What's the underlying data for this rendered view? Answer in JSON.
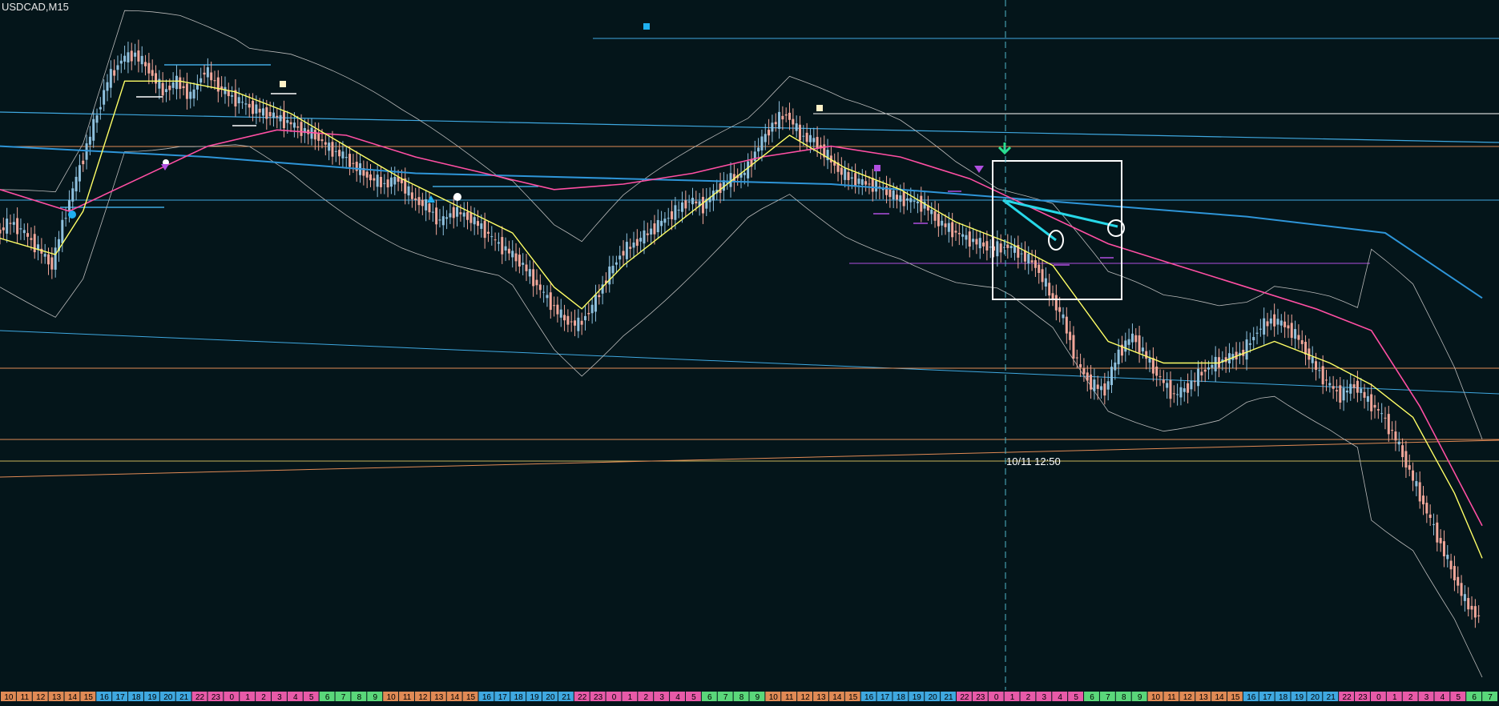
{
  "window": {
    "symbol_title": "USDCAD,M15"
  },
  "colors": {
    "background": "#04151a",
    "candle_up": "#8fc1df",
    "candle_down": "#f2a79a",
    "ema_fast": "#ffff66",
    "ema_slow": "#ff4fa3",
    "ma_long": "#2e95d8",
    "bollinger": "#b9b9b9",
    "support_resistance_cyan": "#3fa8e0",
    "support_resistance_orange": "#e08a55",
    "marker_white": "#ffffff",
    "marker_purple": "#b04fe0",
    "marker_green": "#27e08c",
    "marker_cream": "#fff2c8"
  },
  "chart_data": {
    "type": "candlestick",
    "symbol": "USDCAD",
    "timeframe": "M15",
    "cursor_label": "10/11 12:50",
    "hour_labels": [
      "10",
      "11",
      "12",
      "13",
      "14",
      "15",
      "16",
      "17",
      "18",
      "19",
      "20",
      "21",
      "22",
      "23",
      "0",
      "1",
      "2",
      "3",
      "4",
      "5",
      "6",
      "7",
      "8",
      "9",
      "10",
      "11",
      "12",
      "13",
      "14",
      "15",
      "16",
      "17",
      "18",
      "19",
      "20",
      "21",
      "22",
      "23",
      "0",
      "1",
      "2",
      "3",
      "4",
      "5",
      "6",
      "7",
      "8",
      "9",
      "10",
      "11",
      "12",
      "13",
      "14",
      "15",
      "16",
      "17",
      "18",
      "19",
      "20",
      "21",
      "22",
      "23",
      "0",
      "1",
      "2",
      "3",
      "4",
      "5",
      "6",
      "7",
      "8",
      "9",
      "10",
      "11",
      "12",
      "13",
      "14",
      "15",
      "16",
      "17",
      "18",
      "19",
      "20",
      "21",
      "22",
      "23",
      "0",
      "1",
      "2",
      "3",
      "4",
      "5",
      "6",
      "7"
    ],
    "hour_label_colors": [
      "#e08a55",
      "#e08a55",
      "#e08a55",
      "#e08a55",
      "#e08a55",
      "#e08a55",
      "#3fa8e0",
      "#3fa8e0",
      "#3fa8e0",
      "#3fa8e0",
      "#3fa8e0",
      "#3fa8e0",
      "#e85aa8",
      "#e85aa8",
      "#e85aa8",
      "#e85aa8",
      "#e85aa8",
      "#e85aa8",
      "#e85aa8",
      "#e85aa8",
      "#5ad77a",
      "#5ad77a",
      "#5ad77a",
      "#5ad77a",
      "#e08a55",
      "#e08a55",
      "#e08a55",
      "#e08a55",
      "#e08a55",
      "#e08a55",
      "#3fa8e0",
      "#3fa8e0",
      "#3fa8e0",
      "#3fa8e0",
      "#3fa8e0",
      "#3fa8e0",
      "#e85aa8",
      "#e85aa8",
      "#e85aa8",
      "#e85aa8",
      "#e85aa8",
      "#e85aa8",
      "#e85aa8",
      "#e85aa8",
      "#5ad77a",
      "#5ad77a",
      "#5ad77a",
      "#5ad77a",
      "#e08a55",
      "#e08a55",
      "#e08a55",
      "#e08a55",
      "#e08a55",
      "#e08a55",
      "#3fa8e0",
      "#3fa8e0",
      "#3fa8e0",
      "#3fa8e0",
      "#3fa8e0",
      "#3fa8e0",
      "#e85aa8",
      "#e85aa8",
      "#e85aa8",
      "#e85aa8",
      "#e85aa8",
      "#e85aa8",
      "#e85aa8",
      "#e85aa8",
      "#5ad77a",
      "#5ad77a",
      "#5ad77a",
      "#5ad77a",
      "#e08a55",
      "#e08a55",
      "#e08a55",
      "#e08a55",
      "#e08a55",
      "#e08a55",
      "#3fa8e0",
      "#3fa8e0",
      "#3fa8e0",
      "#3fa8e0",
      "#3fa8e0",
      "#3fa8e0",
      "#e85aa8",
      "#e85aa8",
      "#e85aa8",
      "#e85aa8",
      "#e85aa8",
      "#e85aa8",
      "#e85aa8",
      "#e85aa8",
      "#5ad77a",
      "#5ad77a"
    ],
    "price_path": [
      [
        0,
        0.72
      ],
      [
        4,
        0.73
      ],
      [
        8,
        0.72
      ],
      [
        12,
        0.705
      ],
      [
        16,
        0.69
      ],
      [
        20,
        0.74
      ],
      [
        24,
        0.78
      ],
      [
        28,
        0.82
      ],
      [
        32,
        0.86
      ],
      [
        36,
        0.88
      ],
      [
        40,
        0.885
      ],
      [
        44,
        0.87
      ],
      [
        48,
        0.85
      ],
      [
        52,
        0.86
      ],
      [
        56,
        0.845
      ],
      [
        60,
        0.87
      ],
      [
        64,
        0.855
      ],
      [
        68,
        0.845
      ],
      [
        72,
        0.838
      ],
      [
        76,
        0.832
      ],
      [
        80,
        0.828
      ],
      [
        84,
        0.822
      ],
      [
        88,
        0.815
      ],
      [
        92,
        0.81
      ],
      [
        96,
        0.798
      ],
      [
        100,
        0.791
      ],
      [
        104,
        0.78
      ],
      [
        108,
        0.77
      ],
      [
        112,
        0.765
      ],
      [
        116,
        0.77
      ],
      [
        120,
        0.752
      ],
      [
        124,
        0.745
      ],
      [
        128,
        0.73
      ],
      [
        132,
        0.74
      ],
      [
        136,
        0.735
      ],
      [
        140,
        0.725
      ],
      [
        144,
        0.712
      ],
      [
        148,
        0.702
      ],
      [
        152,
        0.69
      ],
      [
        156,
        0.672
      ],
      [
        160,
        0.655
      ],
      [
        164,
        0.64
      ],
      [
        168,
        0.635
      ],
      [
        172,
        0.652
      ],
      [
        176,
        0.678
      ],
      [
        180,
        0.7
      ],
      [
        184,
        0.71
      ],
      [
        188,
        0.72
      ],
      [
        192,
        0.73
      ],
      [
        196,
        0.74
      ],
      [
        200,
        0.75
      ],
      [
        204,
        0.745
      ],
      [
        208,
        0.76
      ],
      [
        212,
        0.77
      ],
      [
        216,
        0.775
      ],
      [
        220,
        0.8
      ],
      [
        224,
        0.82
      ],
      [
        228,
        0.83
      ],
      [
        232,
        0.81
      ],
      [
        236,
        0.805
      ],
      [
        240,
        0.79
      ],
      [
        244,
        0.775
      ],
      [
        248,
        0.768
      ],
      [
        252,
        0.765
      ],
      [
        256,
        0.76
      ],
      [
        260,
        0.752
      ],
      [
        264,
        0.75
      ],
      [
        268,
        0.745
      ],
      [
        272,
        0.73
      ],
      [
        276,
        0.722
      ],
      [
        280,
        0.715
      ],
      [
        284,
        0.71
      ],
      [
        288,
        0.705
      ],
      [
        292,
        0.708
      ],
      [
        296,
        0.7
      ],
      [
        300,
        0.69
      ],
      [
        304,
        0.665
      ],
      [
        308,
        0.64
      ],
      [
        312,
        0.6
      ],
      [
        316,
        0.58
      ],
      [
        320,
        0.575
      ],
      [
        324,
        0.61
      ],
      [
        328,
        0.625
      ],
      [
        332,
        0.605
      ],
      [
        336,
        0.585
      ],
      [
        340,
        0.57
      ],
      [
        344,
        0.578
      ],
      [
        348,
        0.592
      ],
      [
        352,
        0.6
      ],
      [
        356,
        0.605
      ],
      [
        360,
        0.61
      ],
      [
        364,
        0.63
      ],
      [
        368,
        0.64
      ],
      [
        372,
        0.635
      ],
      [
        376,
        0.622
      ],
      [
        380,
        0.6
      ],
      [
        384,
        0.582
      ],
      [
        388,
        0.57
      ],
      [
        392,
        0.58
      ],
      [
        396,
        0.565
      ],
      [
        400,
        0.552
      ],
      [
        404,
        0.53
      ],
      [
        408,
        0.5
      ],
      [
        412,
        0.47
      ],
      [
        416,
        0.44
      ],
      [
        420,
        0.41
      ],
      [
        424,
        0.38
      ],
      [
        428,
        0.365
      ]
    ],
    "ema_fast": [
      [
        0,
        0.715
      ],
      [
        16,
        0.7
      ],
      [
        24,
        0.74
      ],
      [
        36,
        0.86
      ],
      [
        52,
        0.86
      ],
      [
        68,
        0.85
      ],
      [
        84,
        0.83
      ],
      [
        100,
        0.8
      ],
      [
        116,
        0.77
      ],
      [
        132,
        0.745
      ],
      [
        148,
        0.72
      ],
      [
        160,
        0.67
      ],
      [
        168,
        0.65
      ],
      [
        180,
        0.69
      ],
      [
        196,
        0.73
      ],
      [
        212,
        0.77
      ],
      [
        228,
        0.81
      ],
      [
        244,
        0.78
      ],
      [
        260,
        0.76
      ],
      [
        276,
        0.73
      ],
      [
        292,
        0.71
      ],
      [
        304,
        0.69
      ],
      [
        320,
        0.62
      ],
      [
        336,
        0.6
      ],
      [
        352,
        0.6
      ],
      [
        368,
        0.62
      ],
      [
        384,
        0.6
      ],
      [
        396,
        0.58
      ],
      [
        408,
        0.55
      ],
      [
        420,
        0.48
      ],
      [
        428,
        0.42
      ]
    ],
    "ema_slow": [
      [
        0,
        0.76
      ],
      [
        20,
        0.74
      ],
      [
        40,
        0.77
      ],
      [
        60,
        0.8
      ],
      [
        80,
        0.815
      ],
      [
        100,
        0.81
      ],
      [
        120,
        0.79
      ],
      [
        140,
        0.775
      ],
      [
        160,
        0.76
      ],
      [
        180,
        0.765
      ],
      [
        200,
        0.775
      ],
      [
        220,
        0.79
      ],
      [
        240,
        0.8
      ],
      [
        260,
        0.79
      ],
      [
        280,
        0.77
      ],
      [
        300,
        0.74
      ],
      [
        320,
        0.71
      ],
      [
        340,
        0.69
      ],
      [
        360,
        0.67
      ],
      [
        380,
        0.65
      ],
      [
        396,
        0.63
      ],
      [
        410,
        0.56
      ],
      [
        428,
        0.45
      ]
    ],
    "ma_long": [
      [
        0,
        0.8
      ],
      [
        60,
        0.79
      ],
      [
        120,
        0.775
      ],
      [
        180,
        0.77
      ],
      [
        240,
        0.765
      ],
      [
        300,
        0.75
      ],
      [
        360,
        0.735
      ],
      [
        400,
        0.72
      ],
      [
        428,
        0.66
      ]
    ],
    "title": "",
    "xlabel": "",
    "ylabel": ""
  }
}
